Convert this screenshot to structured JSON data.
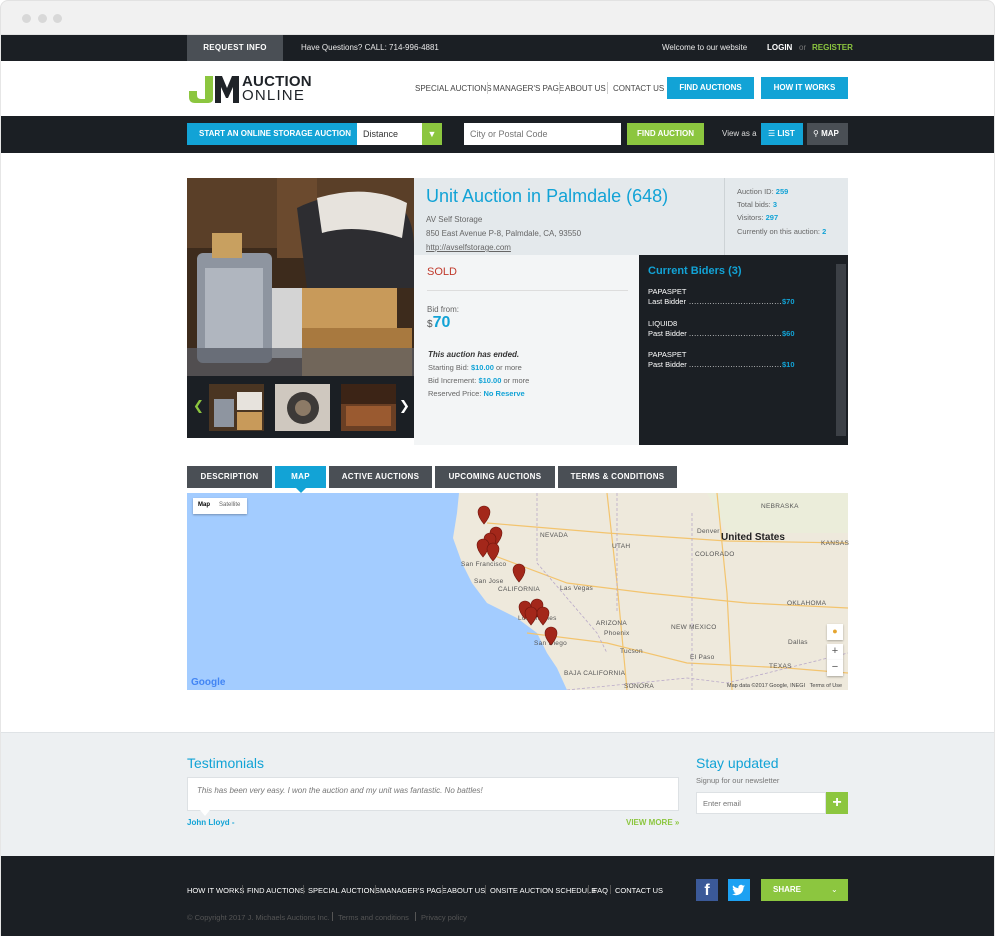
{
  "topbar": {
    "request_info": "REQUEST INFO",
    "question": "Have Questions? CALL: 714-996-4881",
    "welcome": "Welcome to our website",
    "login": "LOGIN",
    "or": "or",
    "register": "REGISTER"
  },
  "header": {
    "logo_mark": "JM",
    "logo_line1": "AUCTION",
    "logo_line2": "ONLINE",
    "nav": [
      "SPECIAL AUCTIONS",
      "MANAGER'S PAGE",
      "ABOUT US",
      "CONTACT US"
    ],
    "find_auctions": "FIND AUCTIONS",
    "how_it_works": "HOW IT WORKS"
  },
  "search": {
    "start_label": "START AN ONLINE STORAGE AUCTION",
    "distance_value": "Distance",
    "city_placeholder": "City or Postal Code",
    "find_label": "FIND AUCTION",
    "view_as": "View as a",
    "list_label": "LIST",
    "map_label": "MAP"
  },
  "auction": {
    "title": "Unit Auction in Palmdale (648)",
    "facility": "AV Self Storage",
    "address": "850 East Avenue P-8, Palmdale, CA, 93550",
    "website": "http://avselfstorage.com",
    "stats": {
      "id_label": "Auction ID:",
      "id_value": "259",
      "bids_label": "Total bids:",
      "bids_value": "3",
      "visitors_label": "Visitors:",
      "visitors_value": "297",
      "current_label": "Currently on this auction:",
      "current_value": "2"
    },
    "status": "SOLD",
    "bid_from_label": "Bid from:",
    "currency": "$",
    "bid_from_value": "70",
    "ended": "This auction has ended.",
    "starting_label": "Starting Bid:",
    "starting_value": "$10.00",
    "starting_suffix": "or more",
    "increment_label": "Bid Increment:",
    "increment_value": "$10.00",
    "increment_suffix": "or more",
    "reserve_label": "Reserved Price:",
    "reserve_value": "No Reserve"
  },
  "bidders": {
    "title": "Current Biders (3)",
    "list": [
      {
        "name": "PAPASPET",
        "role": "Last Bidder",
        "amount": "$70"
      },
      {
        "name": "LIQUID8",
        "role": "Past Bidder",
        "amount": "$60"
      },
      {
        "name": "PAPASPET",
        "role": "Past Bidder",
        "amount": "$10"
      }
    ]
  },
  "tabs": [
    "DESCRIPTION",
    "MAP",
    "ACTIVE AUCTIONS",
    "UPCOMING AUCTIONS",
    "TERMS & CONDITIONS"
  ],
  "map": {
    "toggle_map": "Map",
    "toggle_satellite": "Satellite",
    "country": "United States",
    "labels": [
      "NEBRASKA",
      "NEVADA",
      "UTAH",
      "Denver",
      "COLORADO",
      "KANSAS",
      "San Francisco",
      "San Jose",
      "CALIFORNIA",
      "Las Vegas",
      "ARIZONA",
      "Phoenix",
      "NEW MEXICO",
      "OKLAHOMA",
      "Dallas",
      "Tucson",
      "El Paso",
      "TEXAS",
      "Los Angeles",
      "San Diego",
      "BAJA CALIFORNIA",
      "SONORA"
    ],
    "zoom_in": "+",
    "zoom_out": "−",
    "credit": "Map data ©2017 Google, INEGI",
    "terms": "Terms of Use",
    "google": "Google"
  },
  "testimonials": {
    "title": "Testimonials",
    "quote": "This has been very easy. I won the auction and my unit was fantastic. No battles!",
    "author": "John Lloyd -",
    "view_more": "VIEW MORE »"
  },
  "newsletter": {
    "title": "Stay updated",
    "subtitle": "Signup for our newsletter",
    "placeholder": "Enter email",
    "submit": "+"
  },
  "footer": {
    "nav": [
      "HOW IT WORKS",
      "FIND AUCTIONS",
      "SPECIAL AUCTIONS",
      "MANAGER'S PAGE",
      "ABOUT US",
      "ONSITE AUCTION SCHEDULE",
      "FAQ",
      "CONTACT US"
    ],
    "copyright": "© Copyright 2017 J. Michaels Auctions Inc.",
    "terms": "Terms and conditions",
    "privacy": "Privacy policy",
    "facebook": "f",
    "share": "SHARE"
  },
  "colors": {
    "accent_blue": "#12a3d6",
    "accent_green": "#8cc63f",
    "dark": "#1b1f24",
    "sold_red": "#c0392b"
  }
}
